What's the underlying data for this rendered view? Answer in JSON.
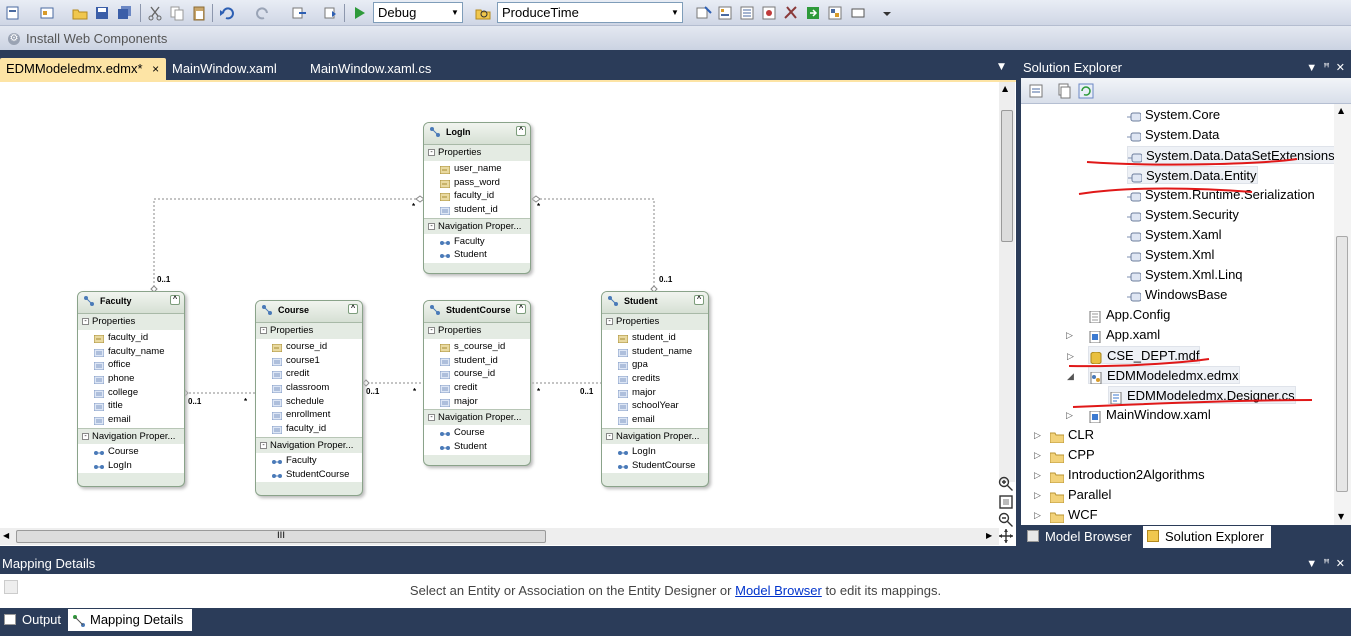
{
  "toolbar": {
    "config_combo": "Debug",
    "target_combo": "ProduceTime",
    "install_web": "Install Web Components"
  },
  "doc_tabs": [
    {
      "label": "EDMModeledmx.edmx*",
      "close": "×"
    },
    {
      "label": "MainWindow.xaml"
    },
    {
      "label": "MainWindow.xaml.cs"
    }
  ],
  "designer": {
    "section_properties": "Properties",
    "section_navigation": "Navigation Proper...",
    "entities": {
      "login": {
        "title": "LogIn",
        "props": [
          "user_name",
          "pass_word",
          "faculty_id",
          "student_id"
        ],
        "nav": [
          "Faculty",
          "Student"
        ]
      },
      "faculty": {
        "title": "Faculty",
        "props": [
          "faculty_id",
          "faculty_name",
          "office",
          "phone",
          "college",
          "title",
          "email"
        ],
        "nav": [
          "Course",
          "LogIn"
        ]
      },
      "course": {
        "title": "Course",
        "props": [
          "course_id",
          "course1",
          "credit",
          "classroom",
          "schedule",
          "enrollment",
          "faculty_id"
        ],
        "nav": [
          "Faculty",
          "StudentCourse"
        ]
      },
      "studentcourse": {
        "title": "StudentCourse",
        "props": [
          "s_course_id",
          "student_id",
          "course_id",
          "credit",
          "major"
        ],
        "nav": [
          "Course",
          "Student"
        ]
      },
      "student": {
        "title": "Student",
        "props": [
          "student_id",
          "student_name",
          "gpa",
          "credits",
          "major",
          "schoolYear",
          "email"
        ],
        "nav": [
          "LogIn",
          "StudentCourse"
        ]
      }
    },
    "multiplicity": {
      "zero_one": "0..1",
      "many": "*"
    },
    "hscroll_grip": "III"
  },
  "solution_explorer": {
    "title": "Solution Explorer",
    "items": [
      {
        "label": "System.Core",
        "icon": "reference-icon"
      },
      {
        "label": "System.Data",
        "icon": "reference-icon"
      },
      {
        "label": "System.Data.DataSetExtensions",
        "icon": "reference-icon"
      },
      {
        "label": "System.Data.Entity",
        "icon": "reference-icon"
      },
      {
        "label": "System.Runtime.Serialization",
        "icon": "reference-icon"
      },
      {
        "label": "System.Security",
        "icon": "reference-icon"
      },
      {
        "label": "System.Xaml",
        "icon": "reference-icon"
      },
      {
        "label": "System.Xml",
        "icon": "reference-icon"
      },
      {
        "label": "System.Xml.Linq",
        "icon": "reference-icon"
      },
      {
        "label": "WindowsBase",
        "icon": "reference-icon"
      },
      {
        "label": "App.Config",
        "icon": "config-file-icon"
      },
      {
        "label": "App.xaml",
        "icon": "xaml-file-icon"
      },
      {
        "label": "CSE_DEPT.mdf",
        "icon": "database-icon"
      },
      {
        "label": "EDMModeledmx.edmx",
        "icon": "edmx-file-icon"
      },
      {
        "label": "EDMModeledmx.Designer.cs",
        "icon": "cs-file-icon"
      },
      {
        "label": "MainWindow.xaml",
        "icon": "xaml-file-icon"
      },
      {
        "label": "CLR",
        "icon": "folder-icon"
      },
      {
        "label": "CPP",
        "icon": "folder-icon"
      },
      {
        "label": "Introduction2Algorithms",
        "icon": "folder-icon"
      },
      {
        "label": "Parallel",
        "icon": "folder-icon"
      },
      {
        "label": "WCF",
        "icon": "folder-icon"
      }
    ],
    "bottom_tabs": [
      "Model Browser",
      "Solution Explorer"
    ]
  },
  "mapping": {
    "title": "Mapping Details",
    "message_before": "Select an Entity or Association on the Entity Designer or",
    "message_link": "Model Browser",
    "message_after": "to edit its mappings."
  },
  "bottom_tabs": [
    "Output",
    "Mapping Details"
  ]
}
